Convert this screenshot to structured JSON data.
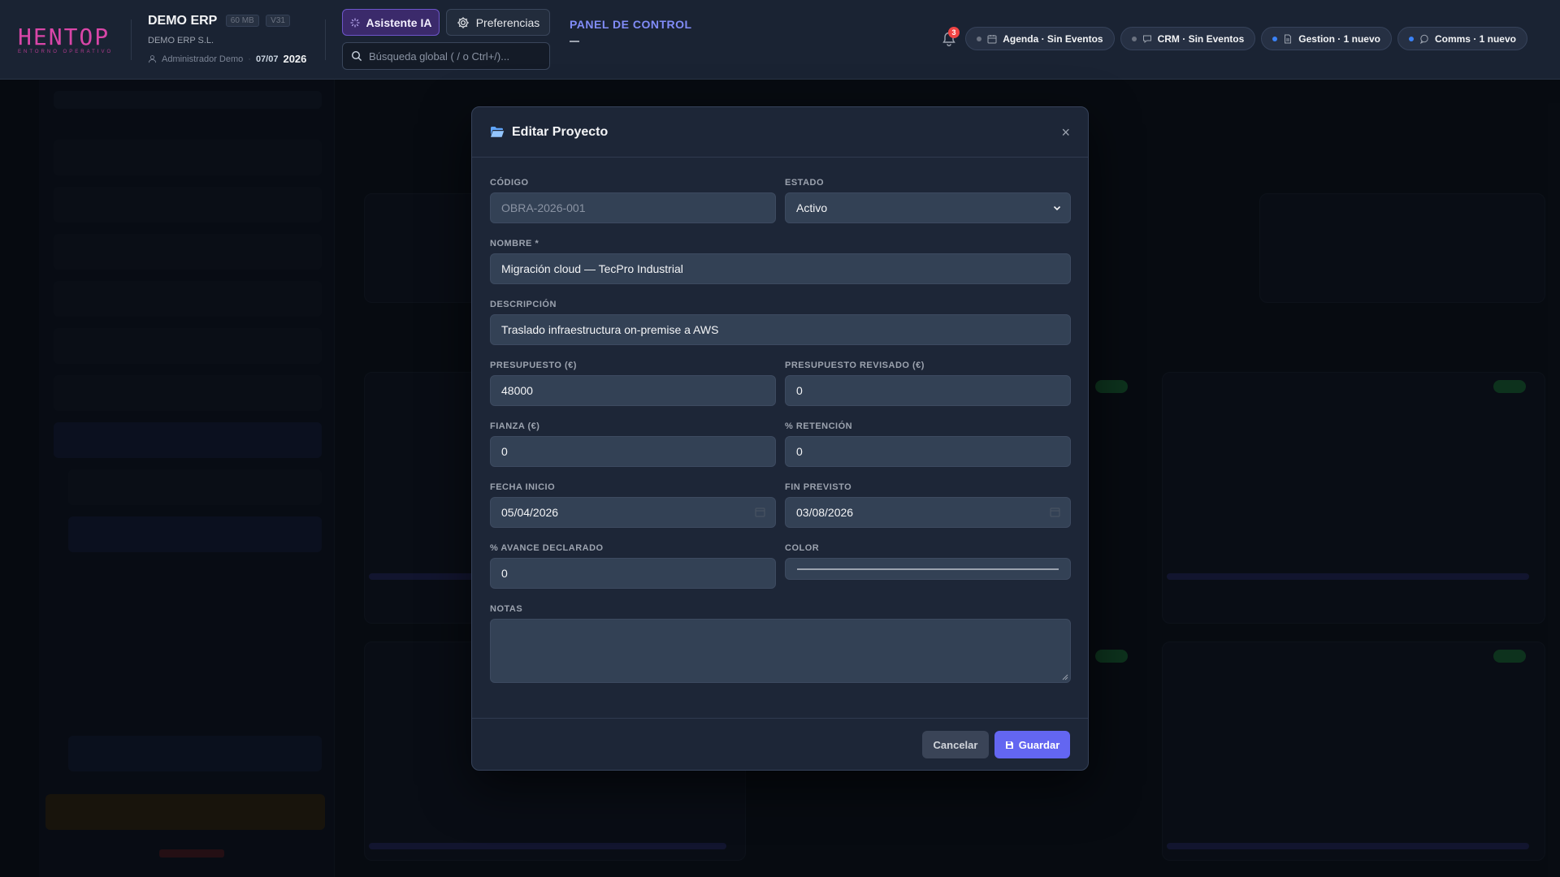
{
  "header": {
    "logo_text": "HENTOP",
    "logo_subtitle": "ENTORNO OPERATIVO",
    "company_name": "DEMO ERP",
    "storage_badge": "60 MB",
    "version_badge": "V31",
    "company_legal": "DEMO ERP S.L.",
    "user": "Administrador Demo",
    "date": "07/07",
    "year": "2026",
    "ai_button": "Asistente IA",
    "preferences_button": "Preferencias",
    "search_placeholder": "Búsqueda global ( / o Ctrl+/)...",
    "panel_title": "PANEL DE CONTROL",
    "notifications_count": "3",
    "chips": [
      {
        "label": "Agenda · Sin Eventos",
        "dot": "gray"
      },
      {
        "label": "CRM · Sin Eventos",
        "dot": "gray"
      },
      {
        "label": "Gestion · 1 nuevo",
        "dot": "blue"
      },
      {
        "label": "Comms · 1 nuevo",
        "dot": "blue"
      }
    ]
  },
  "modal": {
    "title": "Editar Proyecto",
    "close": "×",
    "fields": {
      "codigo": {
        "label": "CÓDIGO",
        "placeholder": "OBRA-2026-001"
      },
      "estado": {
        "label": "ESTADO",
        "value": "Activo"
      },
      "nombre": {
        "label": "NOMBRE *",
        "value": "Migración cloud — TecPro Industrial"
      },
      "descripcion": {
        "label": "DESCRIPCIÓN",
        "value": "Traslado infraestructura on-premise a AWS"
      },
      "presupuesto": {
        "label": "PRESUPUESTO (€)",
        "value": "48000"
      },
      "presupuesto_revisado": {
        "label": "PRESUPUESTO REVISADO (€)",
        "value": "0"
      },
      "fianza": {
        "label": "FIANZA (€)",
        "value": "0"
      },
      "retencion": {
        "label": "% RETENCIÓN",
        "value": "0"
      },
      "fecha_inicio": {
        "label": "FECHA INICIO",
        "value": "05/04/2026"
      },
      "fin_previsto": {
        "label": "FIN PREVISTO",
        "value": "03/08/2026"
      },
      "avance": {
        "label": "% AVANCE DECLARADO",
        "value": "0"
      },
      "color": {
        "label": "COLOR"
      },
      "notas": {
        "label": "NOTAS"
      }
    },
    "cancel_button": "Cancelar",
    "save_button": "Guardar"
  },
  "colors": {
    "accent": "#6366f1",
    "panel_title": "#818cf8",
    "logo": "#d946a8",
    "badge": "#ef4444"
  }
}
